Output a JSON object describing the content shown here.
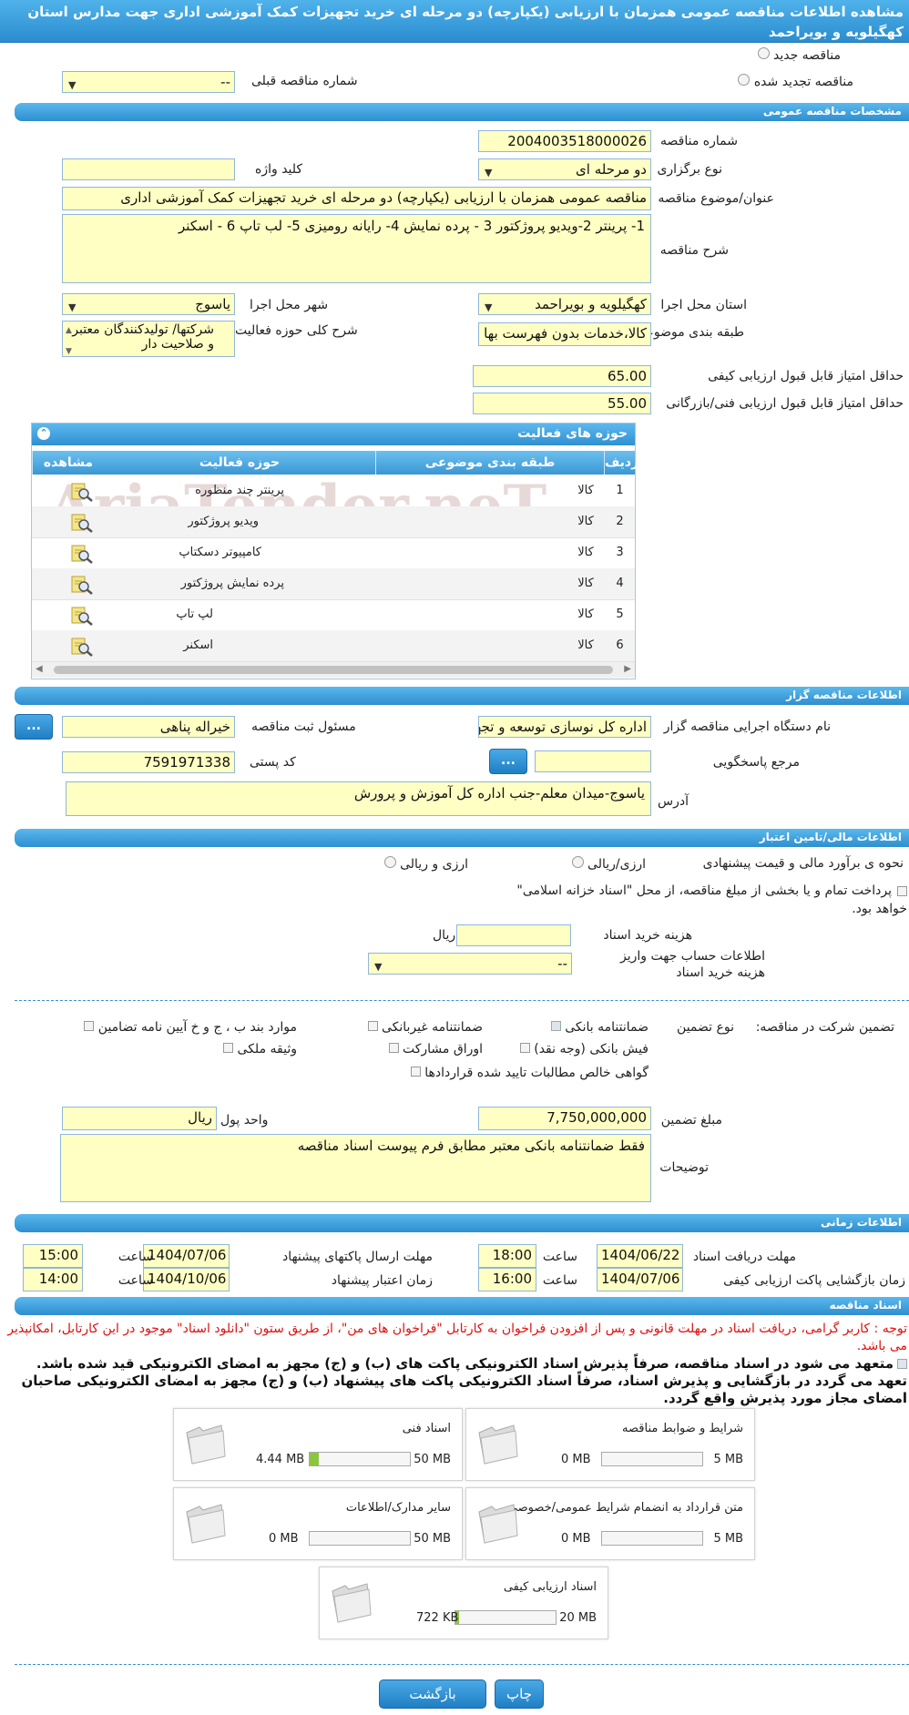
{
  "page_title": "مشاهده اطلاعات مناقصه عمومی همزمان با ارزیابی (یکپارچه) دو مرحله ای خرید تجهیزات کمک آموزشی اداری جهت مدارس استان کهگیلویه و بویراحمد",
  "tender_type": {
    "new_label": "مناقصه جدید",
    "renewed_label": "مناقصه تجدید شده",
    "prev_number_label": "شماره مناقصه قبلی",
    "prev_number_value": "--"
  },
  "general": {
    "section_title": "مشخصات مناقصه عمومی",
    "number_label": "شماره مناقصه",
    "number_value": "2004003518000026",
    "hold_type_label": "نوع برگزاری",
    "hold_type_value": "دو مرحله ای",
    "keyword_label": "کلید واژه",
    "keyword_value": "",
    "subject_label": "عنوان/موضوع مناقصه",
    "subject_value": "مناقصه عمومی همزمان با ارزیابی (یکپارچه) دو مرحله ای خرید تجهیزات کمک آموزشی  اداری",
    "desc_label": "شرح مناقصه",
    "desc_value": "1- پرینتر 2-ویدیو پروژکتور  3 - پرده نمایش 4- رایانه رومیزی  5- لب تاپ  6 - اسکنر",
    "province_label": "استان محل اجرا",
    "province_value": "کهگیلویه و بویراحمد",
    "city_label": "شهر محل اجرا",
    "city_value": "یاسوج",
    "category_label": "طبقه بندی موضوعی",
    "category_value": "کالا،خدمات بدون فهرست بها",
    "activity_desc_label": "شرح کلی حوزه فعالیت",
    "activity_desc_value": "شرکتها/ تولیدکنندگان معتبر و صلاحیت دار",
    "min_quality_label": "حداقل امتیاز قابل قبول ارزیابی کیفی",
    "min_quality_value": "65.00",
    "min_tech_label": "حداقل امتیاز قابل قبول ارزیابی فنی/بازرگانی",
    "min_tech_value": "55.00"
  },
  "activities": {
    "title": "حوزه های فعالیت",
    "headers": {
      "row": "ردیف",
      "category": "طبقه بندی موضوعی",
      "field": "حوزه فعالیت",
      "view": "مشاهده"
    },
    "rows": [
      {
        "n": "1",
        "category": "کالا",
        "field": "پرینتر چند منظوره"
      },
      {
        "n": "2",
        "category": "کالا",
        "field": "ویدیو پروژکتور"
      },
      {
        "n": "3",
        "category": "کالا",
        "field": "کامپیوتر دسکتاپ"
      },
      {
        "n": "4",
        "category": "کالا",
        "field": "پرده نمایش پروژکتور"
      },
      {
        "n": "5",
        "category": "کالا",
        "field": "لپ تاپ"
      },
      {
        "n": "6",
        "category": "کالا",
        "field": "اسکنر"
      }
    ],
    "watermark": "AriaTender.neT"
  },
  "organizer": {
    "section_title": "اطلاعات مناقصه گزار",
    "org_label": "نام دستگاه اجرایی مناقصه گزار",
    "org_value": "اداره کل نوسازی  توسعه و تجهیز مدارس",
    "resp_label": "مسئول ثبت مناقصه",
    "resp_value": "خیراله پناهی",
    "ref_label": "مرجع پاسخگویی",
    "ref_value": "",
    "postal_label": "کد پستی",
    "postal_value": "7591971338",
    "address_label": "آدرس",
    "address_value": "یاسوج-میدان معلم-جنب اداره کل آموزش و پرورش",
    "btn": "..."
  },
  "finance": {
    "section_title": "اطلاعات مالی/تامین اعتبار",
    "estimate_label": "نحوه ی برآورد مالی و قیمت پیشنهادی",
    "opt_rial": "ارزی/ریالی",
    "opt_currency_rial": "ارزی و ریالی",
    "treasury_text": "پرداخت تمام و یا بخشی از مبلغ مناقصه، از محل \"اسناد خزانه اسلامی\" خواهد بود.",
    "doc_cost_label": "هزینه خرید اسناد",
    "doc_cost_value": "",
    "doc_cost_unit": "ریال",
    "account_label": "اطلاعات حساب جهت واریز هزینه خرید اسناد",
    "account_value": "--"
  },
  "guarantee": {
    "title_label": "تضمین شرکت در مناقصه:",
    "type_label": "نوع تضمین",
    "options": {
      "bank_guarantee": "ضمانتنامه بانکی",
      "nonbank_guarantee": "ضمانتنامه غیربانکی",
      "other_items": "موارد بند ب ، ج و خ آیین نامه تضامین",
      "bank_receipt": "فیش بانکی (وجه نقد)",
      "bonds": "اوراق مشارکت",
      "property": "وثیقه ملکی",
      "net_claims": "گواهی خالص مطالبات تایید شده قراردادها"
    },
    "amount_label": "مبلغ تضمین",
    "amount_value": "7,750,000,000",
    "currency_label": "واحد پول",
    "currency_value": "ریال",
    "notes_label": "توضیحات",
    "notes_value": "فقط ضمانتنامه بانکی معتبر مطابق فرم پیوست اسناد مناقصه"
  },
  "timing": {
    "section_title": "اطلاعات زمانی",
    "receive_label": "مهلت دریافت اسناد",
    "receive_date": "1404/06/22",
    "receive_time": "18:00",
    "send_label": "مهلت ارسال پاکتهای پیشنهاد",
    "send_date": "1404/07/06",
    "send_time": "15:00",
    "open_label": "زمان بازگشایی پاکت ارزیابی کیفی",
    "open_date": "1404/07/06",
    "open_time": "16:00",
    "validity_label": "زمان اعتبار پیشنهاد",
    "validity_date": "1404/10/06",
    "validity_time": "14:00",
    "hour_label": "ساعت"
  },
  "documents": {
    "section_title": "اسناد مناقصه",
    "notice": "توجه : کاربر گرامی، دریافت اسناد در مهلت قانونی و پس از افزودن فراخوان به کارتابل \"فراخوان های من\"، از طریق ستون \"دانلود اسناد\" موجود در این کارتابل، امکانپذیر می باشد.",
    "commit": "متعهد می شود در اسناد مناقصه، صرفاً پذیرش اسناد الکترونیکی پاکت های (ب) و (ج) مجهز به امضای الکترونیکی قید شده باشد. تعهد می گردد در بازگشایی و پذیرش اسناد، صرفاً اسناد الکترونیکی پاکت های پیشنهاد (ب) و (ج) مجهز به امضای الکترونیکی صاحبان امضای مجاز مورد پذیرش واقع گردد.",
    "files": [
      {
        "title": "شرایط و ضوابط مناقصه",
        "current": "0 MB",
        "max": "5 MB",
        "fill": 0
      },
      {
        "title": "اسناد فنی",
        "current": "4.44 MB",
        "max": "50 MB",
        "fill": 0.089
      },
      {
        "title": "متن قرارداد به انضمام شرایط عمومی/خصوصی",
        "current": "0 MB",
        "max": "5 MB",
        "fill": 0
      },
      {
        "title": "سایر مدارک/اطلاعات",
        "current": "0 MB",
        "max": "50 MB",
        "fill": 0
      },
      {
        "title": "اسناد ارزیابی کیفی",
        "current": "722 KB",
        "max": "20 MB",
        "fill": 0.035
      }
    ]
  },
  "buttons": {
    "print": "چاپ",
    "back": "بازگشت"
  }
}
